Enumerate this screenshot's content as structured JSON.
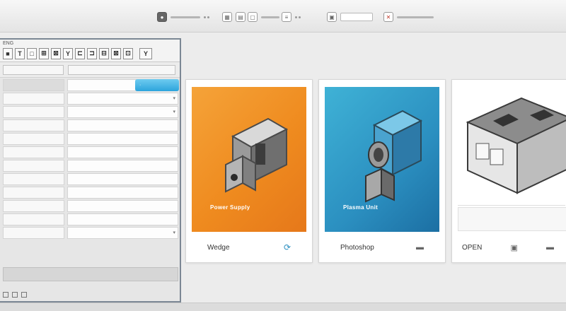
{
  "toolbar": {
    "groups": [
      {
        "icon": "app-icon"
      },
      {
        "icon": "grid-icon"
      },
      {
        "icon": "document-icon"
      },
      {
        "icon": "layers-icon"
      },
      {
        "icon": "settings-icon"
      },
      {
        "icon": "close-icon"
      }
    ]
  },
  "left_panel": {
    "corner_label": "ENG",
    "tabs": [
      "■",
      "T",
      "□",
      "⊞",
      "⊠",
      "Y",
      "⊏",
      "⊐",
      "⊟",
      "⊠",
      "⊡",
      "Y"
    ],
    "selected_value": "·",
    "rows": 12
  },
  "cards": [
    {
      "title": "Power Supply",
      "subtitle": "",
      "caption": "Wedge",
      "icon": "refresh-icon",
      "accent": "#ef8b1f"
    },
    {
      "title": "Plasma Unit",
      "subtitle": "",
      "caption": "Photoshop",
      "icon": "menu-icon",
      "accent": "#2b8fc0"
    },
    {
      "caption": "OPEN",
      "icon": "device-icon",
      "accent": "#666666"
    }
  ],
  "colors": {
    "panel_border": "#7b8794",
    "selection": "#2ca4dc",
    "orange_card": "#ef8b1f",
    "blue_card": "#2b8fc0"
  }
}
